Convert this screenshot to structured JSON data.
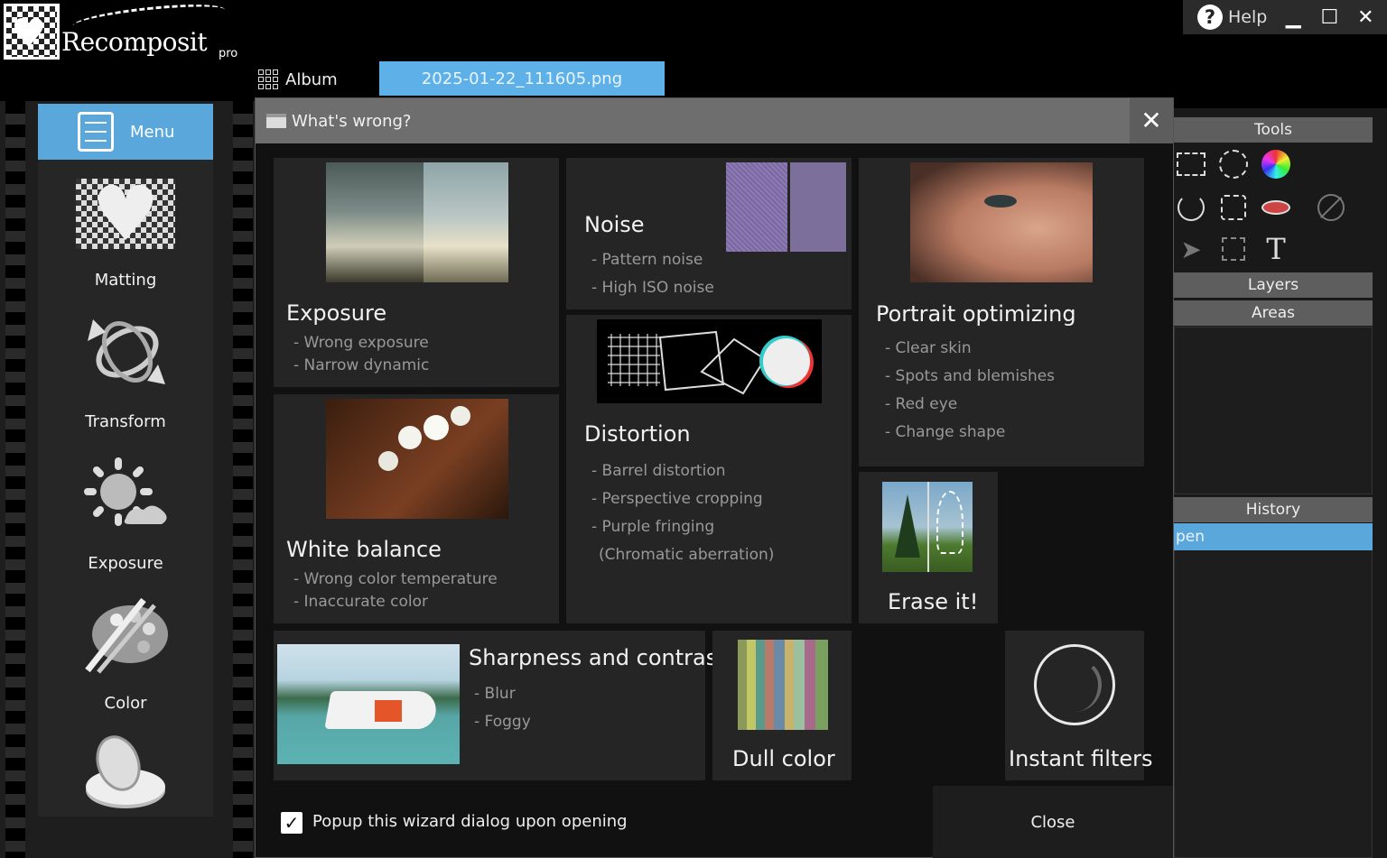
{
  "app": {
    "name": "Recomposit",
    "edition": "pro"
  },
  "window_controls": {
    "help_label": "Help",
    "minimize": "▁",
    "maximize": "☐",
    "close": "✕"
  },
  "tabs": {
    "album_label": "Album",
    "file_label": "2025-01-22_111605.png"
  },
  "sidebar": {
    "menu_label": "Menu",
    "items": [
      {
        "label": "Matting",
        "icon": "matting-heart-icon"
      },
      {
        "label": "Transform",
        "icon": "transform-icon"
      },
      {
        "label": "Exposure",
        "icon": "exposure-sun-icon"
      },
      {
        "label": "Color",
        "icon": "palette-icon"
      },
      {
        "label": "",
        "icon": "compact-mirror-icon"
      }
    ]
  },
  "dialog": {
    "title": "What's wrong?",
    "tiles": {
      "exposure": {
        "title": "Exposure",
        "items": [
          "- Wrong exposure",
          "- Narrow dynamic"
        ]
      },
      "noise": {
        "title": "Noise",
        "items": [
          "- Pattern noise",
          "- High ISO noise"
        ]
      },
      "portrait": {
        "title": "Portrait optimizing",
        "items": [
          "- Clear skin",
          "- Spots and blemishes",
          "- Red eye",
          "- Change shape"
        ]
      },
      "white_balance": {
        "title": "White balance",
        "items": [
          "- Wrong color temperature",
          "- Inaccurate color"
        ]
      },
      "distortion": {
        "title": "Distortion",
        "items": [
          "- Barrel distortion",
          "- Perspective cropping",
          "- Purple fringing",
          "(Chromatic aberration)"
        ]
      },
      "erase": {
        "title": "Erase it!"
      },
      "sharpness": {
        "title": "Sharpness and contrast",
        "items": [
          "- Blur",
          "- Foggy"
        ]
      },
      "dull": {
        "title": "Dull color"
      },
      "instant": {
        "title": "Instant filters"
      }
    },
    "footer": {
      "checkbox_label": "Popup this wizard dialog upon opening",
      "checkbox_checked": true,
      "close_label": "Close"
    }
  },
  "right_panel": {
    "tools_title": "Tools",
    "layers_title": "Layers",
    "areas_title": "Areas",
    "history_title": "History",
    "history_items": [
      "pen"
    ]
  },
  "colors": {
    "accent": "#5aa7dc",
    "file_tab": "#5db1e8",
    "panel": "#252525",
    "titlebar": "#6e6e6e"
  }
}
